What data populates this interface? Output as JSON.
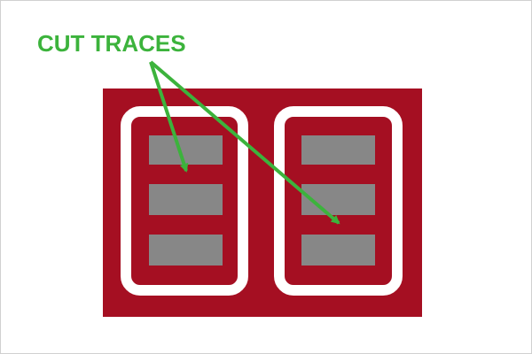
{
  "annotation": {
    "label": "CUT TRACES",
    "color": "#3cb33c"
  },
  "colors": {
    "board": "#a50f22",
    "isolation": "#ffffff",
    "pad": "#878787",
    "background": "#ffffff"
  },
  "pad_groups": [
    {
      "name": "left-pad-group",
      "pad_count": 3
    },
    {
      "name": "right-pad-group",
      "pad_count": 3
    }
  ]
}
